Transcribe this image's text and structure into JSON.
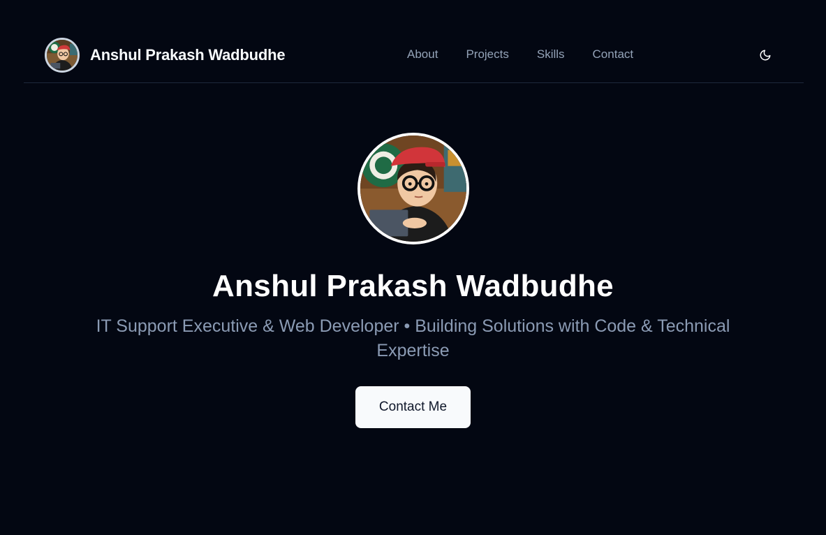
{
  "nav": {
    "brand_name": "Anshul Prakash Wadbudhe",
    "links": [
      {
        "label": "About"
      },
      {
        "label": "Projects"
      },
      {
        "label": "Skills"
      },
      {
        "label": "Contact"
      }
    ],
    "theme_toggle_icon": "moon-icon"
  },
  "hero": {
    "avatar_icon": "profile-avatar",
    "title": "Anshul Prakash Wadbudhe",
    "subtitle": "IT Support Executive & Web Developer • Building Solutions with Code & Technical Expertise",
    "cta_label": "Contact Me"
  },
  "colors": {
    "background": "#030712",
    "text_primary": "#ffffff",
    "text_muted": "#94a3b8",
    "button_bg": "#f8fafc",
    "button_text": "#0f172a"
  }
}
